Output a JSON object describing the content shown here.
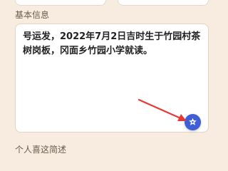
{
  "section": {
    "title": "基本信息"
  },
  "basic_info": {
    "text": "号运发，2022年7月2日吉时生于竹园村茶树岗板，冈面乡竹园小学就读。"
  },
  "next_section": {
    "title": "个人喜这简述"
  },
  "ai_button": {
    "icon": "sparkle-icon",
    "color": "#3f5ed8"
  },
  "annotation": {
    "arrow_color": "#e53935"
  }
}
